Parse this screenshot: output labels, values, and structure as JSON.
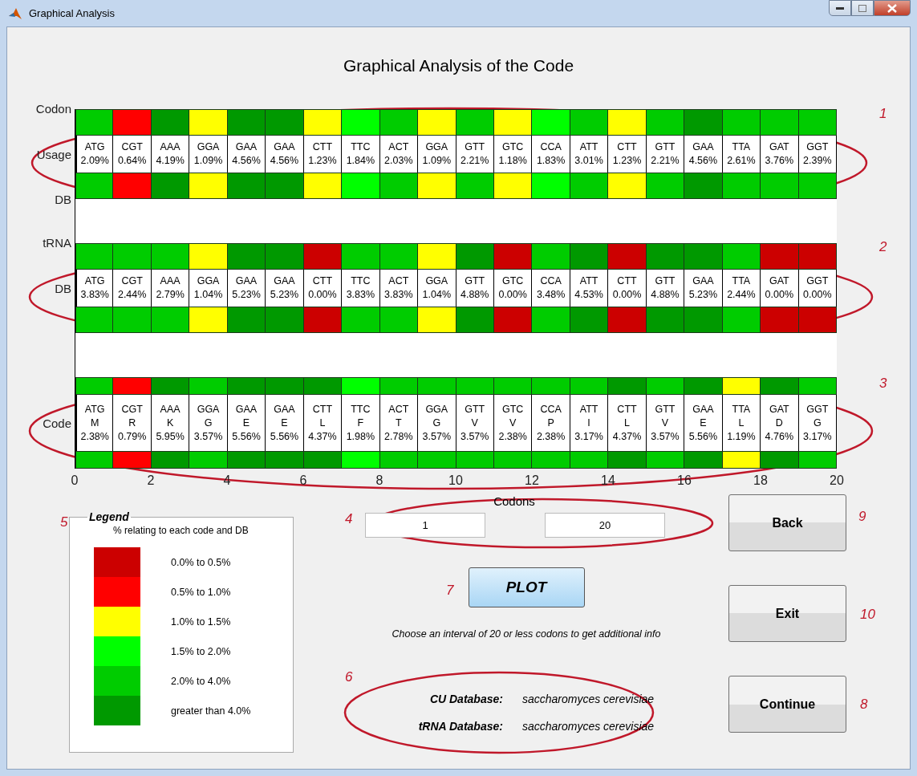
{
  "window": {
    "title": "Graphical Analysis"
  },
  "heading": "Graphical Analysis of the Code",
  "panels": [
    {
      "label_top": "Codon",
      "label_middle": "Usage",
      "label_bottom": "DB",
      "cells": [
        {
          "codon": "ATG",
          "value": "2.09%",
          "color": "#00cc00"
        },
        {
          "codon": "CGT",
          "value": "0.64%",
          "color": "#ff0000"
        },
        {
          "codon": "AAA",
          "value": "4.19%",
          "color": "#009900"
        },
        {
          "codon": "GGA",
          "value": "1.09%",
          "color": "#ffff00"
        },
        {
          "codon": "GAA",
          "value": "4.56%",
          "color": "#009900"
        },
        {
          "codon": "GAA",
          "value": "4.56%",
          "color": "#009900"
        },
        {
          "codon": "CTT",
          "value": "1.23%",
          "color": "#ffff00"
        },
        {
          "codon": "TTC",
          "value": "1.84%",
          "color": "#00ff00"
        },
        {
          "codon": "ACT",
          "value": "2.03%",
          "color": "#00cc00"
        },
        {
          "codon": "GGA",
          "value": "1.09%",
          "color": "#ffff00"
        },
        {
          "codon": "GTT",
          "value": "2.21%",
          "color": "#00cc00"
        },
        {
          "codon": "GTC",
          "value": "1.18%",
          "color": "#ffff00"
        },
        {
          "codon": "CCA",
          "value": "1.83%",
          "color": "#00ff00"
        },
        {
          "codon": "ATT",
          "value": "3.01%",
          "color": "#00cc00"
        },
        {
          "codon": "CTT",
          "value": "1.23%",
          "color": "#ffff00"
        },
        {
          "codon": "GTT",
          "value": "2.21%",
          "color": "#00cc00"
        },
        {
          "codon": "GAA",
          "value": "4.56%",
          "color": "#009900"
        },
        {
          "codon": "TTA",
          "value": "2.61%",
          "color": "#00cc00"
        },
        {
          "codon": "GAT",
          "value": "3.76%",
          "color": "#00cc00"
        },
        {
          "codon": "GGT",
          "value": "2.39%",
          "color": "#00cc00"
        }
      ]
    },
    {
      "label_top": "tRNA",
      "label_middle": "DB",
      "cells": [
        {
          "codon": "ATG",
          "value": "3.83%",
          "color": "#00cc00"
        },
        {
          "codon": "CGT",
          "value": "2.44%",
          "color": "#00cc00"
        },
        {
          "codon": "AAA",
          "value": "2.79%",
          "color": "#00cc00"
        },
        {
          "codon": "GGA",
          "value": "1.04%",
          "color": "#ffff00"
        },
        {
          "codon": "GAA",
          "value": "5.23%",
          "color": "#009900"
        },
        {
          "codon": "GAA",
          "value": "5.23%",
          "color": "#009900"
        },
        {
          "codon": "CTT",
          "value": "0.00%",
          "color": "#cc0000"
        },
        {
          "codon": "TTC",
          "value": "3.83%",
          "color": "#00cc00"
        },
        {
          "codon": "ACT",
          "value": "3.83%",
          "color": "#00cc00"
        },
        {
          "codon": "GGA",
          "value": "1.04%",
          "color": "#ffff00"
        },
        {
          "codon": "GTT",
          "value": "4.88%",
          "color": "#009900"
        },
        {
          "codon": "GTC",
          "value": "0.00%",
          "color": "#cc0000"
        },
        {
          "codon": "CCA",
          "value": "3.48%",
          "color": "#00cc00"
        },
        {
          "codon": "ATT",
          "value": "4.53%",
          "color": "#009900"
        },
        {
          "codon": "CTT",
          "value": "0.00%",
          "color": "#cc0000"
        },
        {
          "codon": "GTT",
          "value": "4.88%",
          "color": "#009900"
        },
        {
          "codon": "GAA",
          "value": "5.23%",
          "color": "#009900"
        },
        {
          "codon": "TTA",
          "value": "2.44%",
          "color": "#00cc00"
        },
        {
          "codon": "GAT",
          "value": "0.00%",
          "color": "#cc0000"
        },
        {
          "codon": "GGT",
          "value": "0.00%",
          "color": "#cc0000"
        }
      ]
    },
    {
      "label_middle": "Code",
      "cells": [
        {
          "codon": "ATG",
          "amino": "M",
          "value": "2.38%",
          "color": "#00cc00"
        },
        {
          "codon": "CGT",
          "amino": "R",
          "value": "0.79%",
          "color": "#ff0000"
        },
        {
          "codon": "AAA",
          "amino": "K",
          "value": "5.95%",
          "color": "#009900"
        },
        {
          "codon": "GGA",
          "amino": "G",
          "value": "3.57%",
          "color": "#00cc00"
        },
        {
          "codon": "GAA",
          "amino": "E",
          "value": "5.56%",
          "color": "#009900"
        },
        {
          "codon": "GAA",
          "amino": "E",
          "value": "5.56%",
          "color": "#009900"
        },
        {
          "codon": "CTT",
          "amino": "L",
          "value": "4.37%",
          "color": "#009900"
        },
        {
          "codon": "TTC",
          "amino": "F",
          "value": "1.98%",
          "color": "#00ff00"
        },
        {
          "codon": "ACT",
          "amino": "T",
          "value": "2.78%",
          "color": "#00cc00"
        },
        {
          "codon": "GGA",
          "amino": "G",
          "value": "3.57%",
          "color": "#00cc00"
        },
        {
          "codon": "GTT",
          "amino": "V",
          "value": "3.57%",
          "color": "#00cc00"
        },
        {
          "codon": "GTC",
          "amino": "V",
          "value": "2.38%",
          "color": "#00cc00"
        },
        {
          "codon": "CCA",
          "amino": "P",
          "value": "2.38%",
          "color": "#00cc00"
        },
        {
          "codon": "ATT",
          "amino": "I",
          "value": "3.17%",
          "color": "#00cc00"
        },
        {
          "codon": "CTT",
          "amino": "L",
          "value": "4.37%",
          "color": "#009900"
        },
        {
          "codon": "GTT",
          "amino": "V",
          "value": "3.57%",
          "color": "#00cc00"
        },
        {
          "codon": "GAA",
          "amino": "E",
          "value": "5.56%",
          "color": "#009900"
        },
        {
          "codon": "TTA",
          "amino": "L",
          "value": "1.19%",
          "color": "#ffff00"
        },
        {
          "codon": "GAT",
          "amino": "D",
          "value": "4.76%",
          "color": "#009900"
        },
        {
          "codon": "GGT",
          "amino": "G",
          "value": "3.17%",
          "color": "#00cc00"
        }
      ]
    }
  ],
  "x_axis": {
    "ticks": [
      "0",
      "2",
      "4",
      "6",
      "8",
      "10",
      "12",
      "14",
      "16",
      "18",
      "20"
    ],
    "label": "Codons"
  },
  "legend": {
    "title": "Legend",
    "subtitle": "% relating to each code and DB",
    "items": [
      {
        "label": "0.0% to 0.5%",
        "color": "#cc0000"
      },
      {
        "label": "0.5% to 1.0%",
        "color": "#ff0000"
      },
      {
        "label": "1.0% to 1.5%",
        "color": "#ffff00"
      },
      {
        "label": "1.5% to 2.0%",
        "color": "#00ff00"
      },
      {
        "label": "2.0% to 4.0%",
        "color": "#00cc00"
      },
      {
        "label": "greater than 4.0%",
        "color": "#009900"
      }
    ]
  },
  "range": {
    "from": "1",
    "to": "20"
  },
  "plot_button": "PLOT",
  "hint": "Choose an interval of 20 or less codons to get additional info",
  "databases": [
    {
      "label": "CU  Database:",
      "value": "saccharomyces cerevisiae"
    },
    {
      "label": "tRNA Database:",
      "value": "saccharomyces cerevisiae"
    }
  ],
  "buttons": [
    "Back",
    "Exit",
    "Continue"
  ],
  "annotations": [
    "1",
    "2",
    "3",
    "5",
    "4",
    "9",
    "7",
    "10",
    "6",
    "8"
  ]
}
